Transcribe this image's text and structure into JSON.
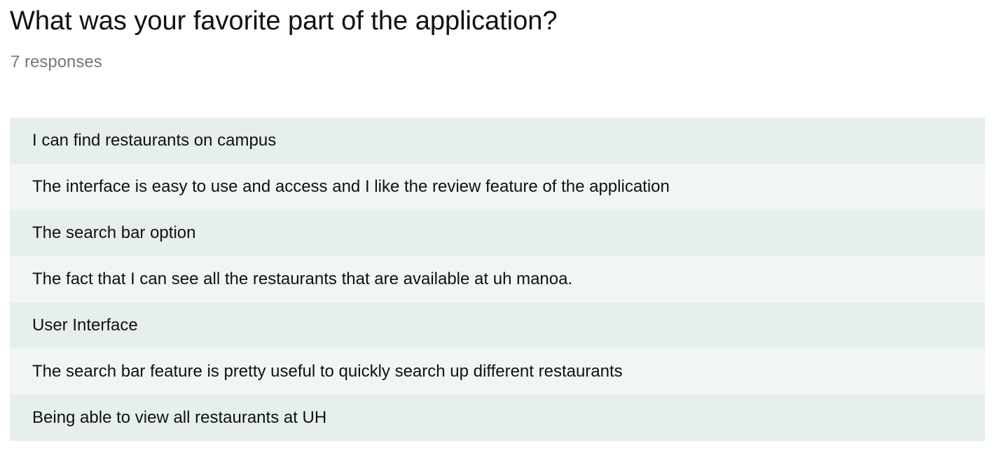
{
  "question": {
    "title": "What was your favorite part of the application?",
    "response_count": "7 responses"
  },
  "responses": [
    "I can find restaurants on campus",
    "The interface is easy to use and access and I like the review feature of the application",
    "The search bar option",
    "The fact that I can see all the restaurants that are available at uh manoa.",
    "User Interface",
    "The search bar feature is pretty useful to quickly search up different restaurants",
    "Being able to view all restaurants at UH"
  ],
  "colors": {
    "row_odd": "#e6efed",
    "row_even": "#f1f6f5",
    "muted_text": "#777777"
  }
}
